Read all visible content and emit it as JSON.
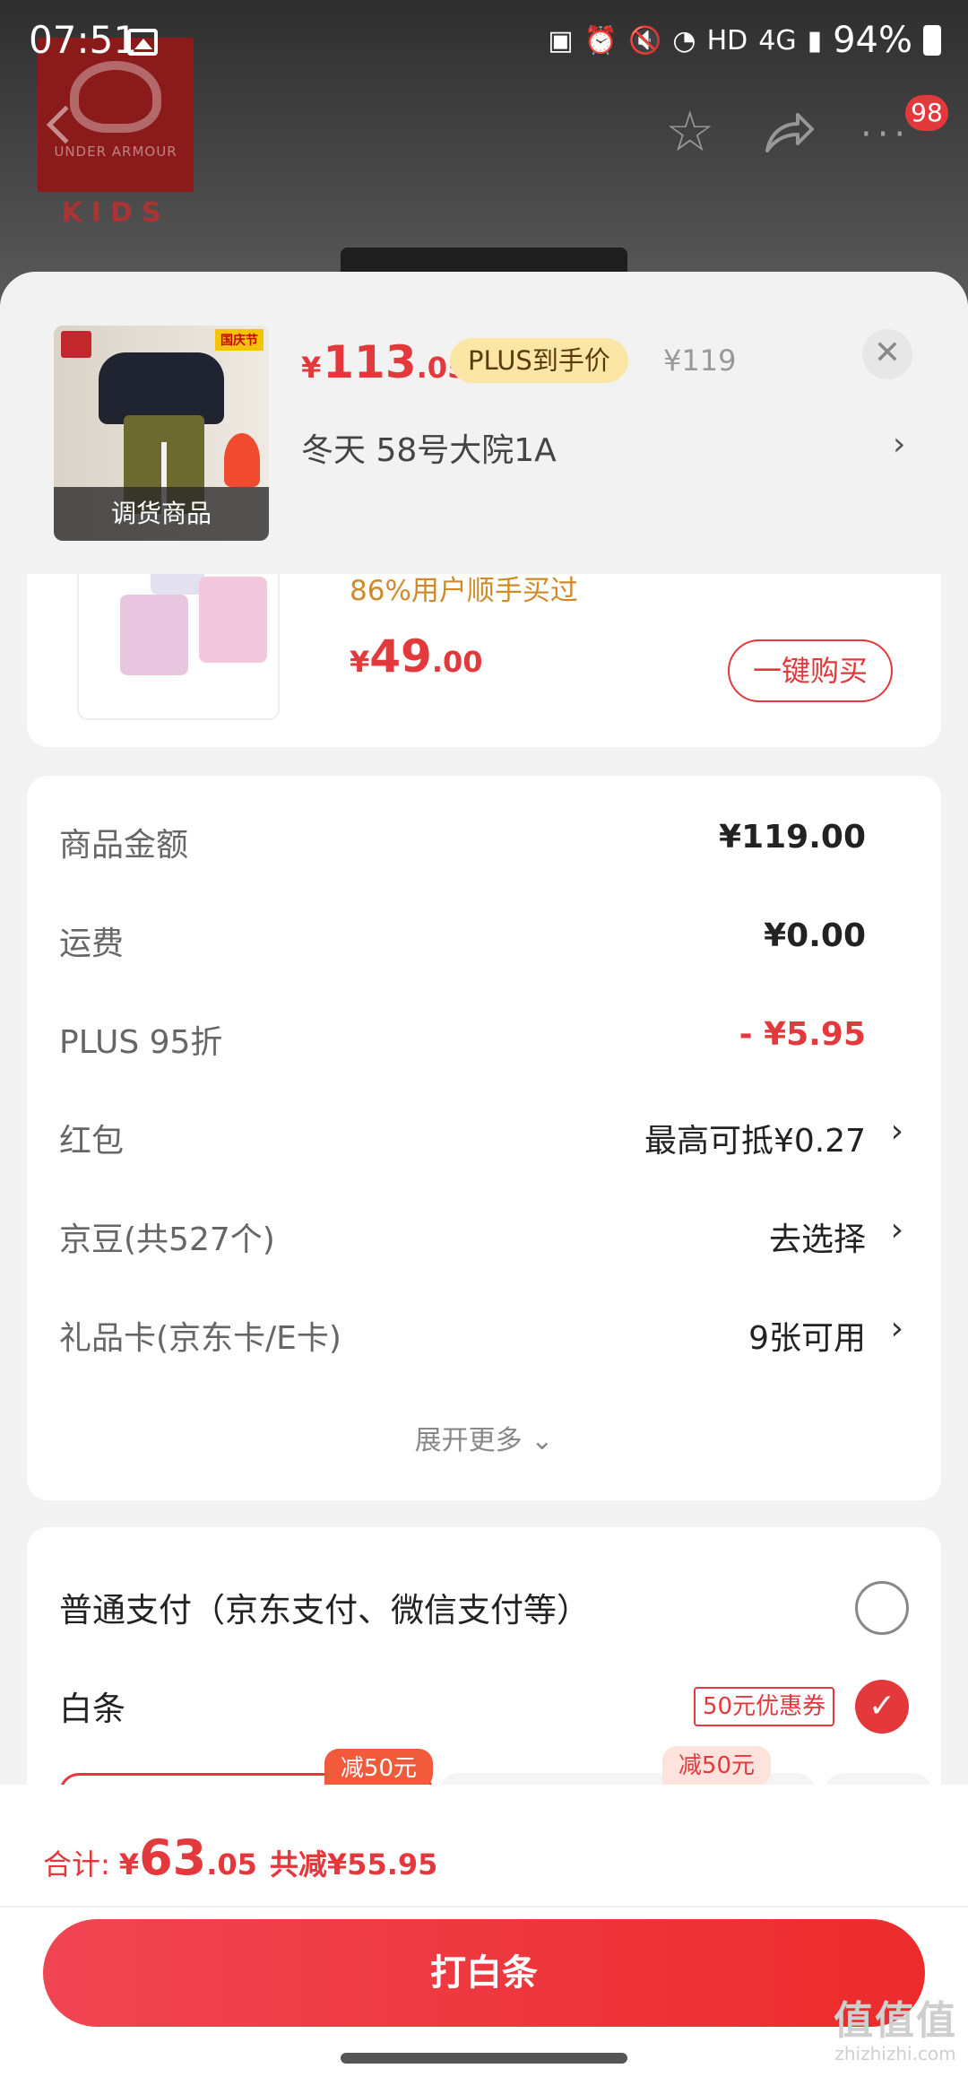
{
  "status_bar": {
    "time": "07:51",
    "network": "HD",
    "signal": "4G",
    "battery": "94%"
  },
  "background_page": {
    "brand_logo_text": "UNDER ARMOUR",
    "brand_sub": "KIDS",
    "cart_badge": "98"
  },
  "product": {
    "price_yen": "¥",
    "price_int": "113",
    "price_dec": ".05",
    "plus_label": "PLUS到手价",
    "original_price": "¥119",
    "thumbnail_caption": "调货商品",
    "thumbnail_tag": "国庆节",
    "address": "冬天  58号大院1A"
  },
  "recommend": {
    "tip": "86%用户顺手买过",
    "price_yen": "¥",
    "price_int": "49",
    "price_dec": ".00",
    "buy_label": "一键购买"
  },
  "costs": {
    "rows": [
      {
        "label": "商品金额",
        "value": "¥119.00"
      },
      {
        "label": "运费",
        "value": "¥0.00"
      },
      {
        "label": "PLUS 95折",
        "value": "- ¥5.95"
      },
      {
        "label": "红包",
        "value": "最高可抵¥0.27"
      },
      {
        "label": "京豆(共527个)",
        "value": "去选择"
      },
      {
        "label": "礼品卡(京东卡/E卡)",
        "value": "9张可用"
      }
    ],
    "expand_label": "展开更多"
  },
  "payment": {
    "normal_label": "普通支付（京东支付、微信支付等）",
    "baitiao_label": "白条",
    "coupon_label": "50元优惠券",
    "plan_tags": [
      "减50元",
      "减50元"
    ]
  },
  "footer": {
    "total_label": "合计:",
    "total_yen": "¥",
    "total_int": "63",
    "total_dec": ".05",
    "saved": "共减¥55.95",
    "pay_button": "打白条"
  },
  "watermark": {
    "big": "值值值",
    "small": "zhizhizhi.com"
  },
  "colors": {
    "accent": "#e4393c",
    "plus_badge_bg": "#fbe6a6",
    "tip_orange": "#d08a2a"
  }
}
